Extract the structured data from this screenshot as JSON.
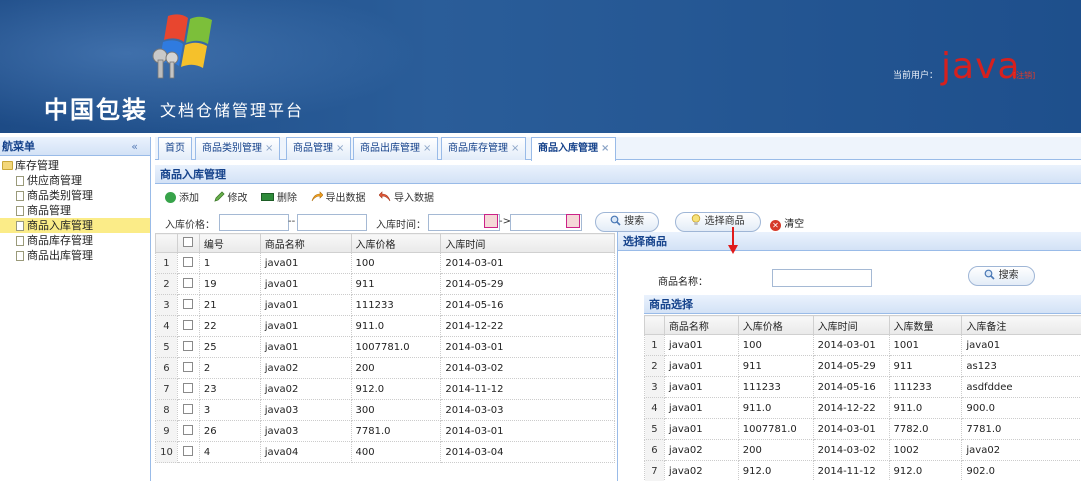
{
  "header": {
    "brand": "中国包装",
    "subtitle": "文档仓储管理平台",
    "user_label": "当前用户：",
    "user_name": "java",
    "logout": "[注销]"
  },
  "nav": {
    "title": "航菜单",
    "collapse": "«",
    "root": "库存管理",
    "items": [
      "供应商管理",
      "商品类别管理",
      "商品管理",
      "商品入库管理",
      "商品库存管理",
      "商品出库管理"
    ],
    "active_index": 3
  },
  "tabs": [
    {
      "label": "首页",
      "closable": false
    },
    {
      "label": "商品类别管理",
      "closable": true
    },
    {
      "label": "商品管理",
      "closable": true
    },
    {
      "label": "商品出库管理",
      "closable": true
    },
    {
      "label": "商品库存管理",
      "closable": true
    },
    {
      "label": "商品入库管理",
      "closable": true,
      "active": true
    }
  ],
  "tab_close": "×",
  "panel": {
    "title": "商品入库管理",
    "toolbar": {
      "add": "添加",
      "edit": "修改",
      "delete": "删除",
      "export": "导出数据",
      "import": "导入数据"
    },
    "filter": {
      "price_label": "入库价格：",
      "price_sep": "--",
      "time_label": "入库时间：",
      "time_sep": "->",
      "search": "搜索",
      "select_product": "选择商品",
      "clear": "清空"
    }
  },
  "left_grid": {
    "columns": [
      "编号",
      "商品名称",
      "入库价格",
      "入库时间"
    ],
    "rows": [
      [
        "1",
        "1",
        "java01",
        "100",
        "2014-03-01"
      ],
      [
        "2",
        "19",
        "java01",
        "911",
        "2014-05-29"
      ],
      [
        "3",
        "21",
        "java01",
        "111233",
        "2014-05-16"
      ],
      [
        "4",
        "22",
        "java01",
        "911.0",
        "2014-12-22"
      ],
      [
        "5",
        "25",
        "java01",
        "1007781.0",
        "2014-03-01"
      ],
      [
        "6",
        "2",
        "java02",
        "200",
        "2014-03-02"
      ],
      [
        "7",
        "23",
        "java02",
        "912.0",
        "2014-11-12"
      ],
      [
        "8",
        "3",
        "java03",
        "300",
        "2014-03-03"
      ],
      [
        "9",
        "26",
        "java03",
        "7781.0",
        "2014-03-01"
      ],
      [
        "10",
        "4",
        "java04",
        "400",
        "2014-03-04"
      ]
    ]
  },
  "dialog": {
    "title": "选择商品",
    "name_label": "商品名称：",
    "search": "搜索",
    "grid_title": "商品选择",
    "columns": [
      "商品名称",
      "入库价格",
      "入库时间",
      "入库数量",
      "入库备注"
    ],
    "rows": [
      [
        "1",
        "java01",
        "100",
        "2014-03-01",
        "1001",
        "java01"
      ],
      [
        "2",
        "java01",
        "911",
        "2014-05-29",
        "911",
        "as123"
      ],
      [
        "3",
        "java01",
        "111233",
        "2014-05-16",
        "111233",
        "asdfddee"
      ],
      [
        "4",
        "java01",
        "911.0",
        "2014-12-22",
        "911.0",
        "900.0"
      ],
      [
        "5",
        "java01",
        "1007781.0",
        "2014-03-01",
        "7782.0",
        "7781.0"
      ],
      [
        "6",
        "java02",
        "200",
        "2014-03-02",
        "1002",
        "java02"
      ],
      [
        "7",
        "java02",
        "912.0",
        "2014-11-12",
        "912.0",
        "902.0"
      ]
    ]
  },
  "colors": {
    "header_bg": "#1f4f8c",
    "accent": "#15428b",
    "user_red": "#d6201e",
    "active_nav": "#fbec88",
    "arrow": "#e01b1b"
  },
  "icons": {
    "logo": "windows-keys-logo",
    "add": "add-icon",
    "edit": "pencil-icon",
    "delete": "delete-icon",
    "export": "export-icon",
    "import": "import-icon",
    "search": "magnifier-icon",
    "select": "lightbulb-icon",
    "clear": "clear-icon",
    "calendar": "calendar-icon"
  }
}
